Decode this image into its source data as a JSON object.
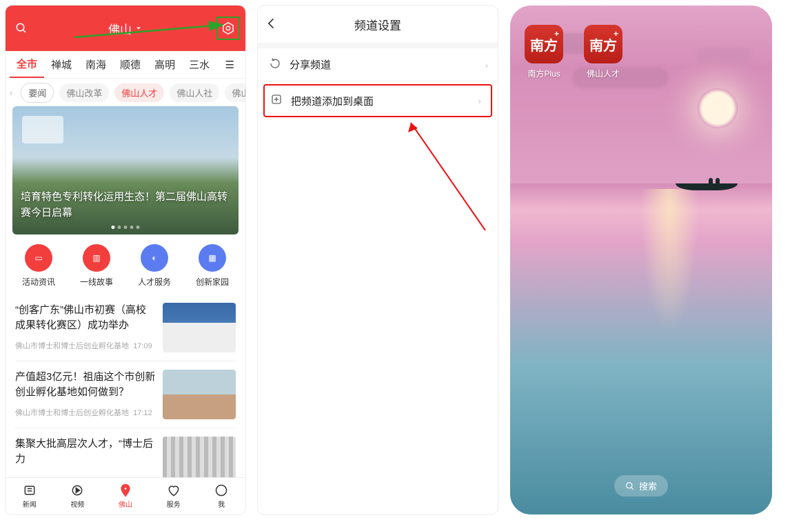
{
  "screen1": {
    "location": "佛山",
    "tabs1": [
      "全市",
      "禅城",
      "南海",
      "顺德",
      "高明",
      "三水"
    ],
    "tabs1_active": 0,
    "tabs2": [
      "要闻",
      "佛山改革",
      "佛山人才",
      "佛山人社",
      "佛山三"
    ],
    "tabs2_active": 2,
    "hero_headline": "培育特色专利转化运用生态！第二届佛山高转赛今日启幕",
    "quick": [
      {
        "label": "活动资讯",
        "icon": "card-icon",
        "color": "r"
      },
      {
        "label": "一线故事",
        "icon": "book-icon",
        "color": "r"
      },
      {
        "label": "人才服务",
        "icon": "globe-icon",
        "color": "b"
      },
      {
        "label": "创新家园",
        "icon": "building-icon",
        "color": "b"
      }
    ],
    "news": [
      {
        "title": "“创客广东”佛山市初赛（高校成果转化赛区）成功举办",
        "src": "佛山市博士和博士后创业孵化基地",
        "time": "17:09",
        "thumb": "t1"
      },
      {
        "title": "产值超3亿元！祖庙这个市创新创业孵化基地如何做到？",
        "src": "佛山市博士和博士后创业孵化基地",
        "time": "17:12",
        "thumb": "t2"
      },
      {
        "title": "集聚大批高层次人才，“博士后力",
        "src": "",
        "time": "",
        "thumb": "t3"
      }
    ],
    "bottom": [
      {
        "label": "新闻",
        "icon": "news-icon"
      },
      {
        "label": "视频",
        "icon": "video-icon"
      },
      {
        "label": "佛山",
        "icon": "pin-icon"
      },
      {
        "label": "服务",
        "icon": "heart-icon"
      },
      {
        "label": "我",
        "icon": "person-icon"
      }
    ],
    "bottom_active": 2
  },
  "screen2": {
    "title": "频道设置",
    "rows": [
      {
        "icon": "share-icon",
        "label": "分享频道"
      },
      {
        "icon": "add-box-icon",
        "label": "把频道添加到桌面"
      }
    ]
  },
  "screen3": {
    "apps": [
      {
        "glyph": "南方",
        "label": "南方Plus"
      },
      {
        "glyph": "南方",
        "label": "佛山人才"
      }
    ],
    "search_label": "搜索"
  }
}
